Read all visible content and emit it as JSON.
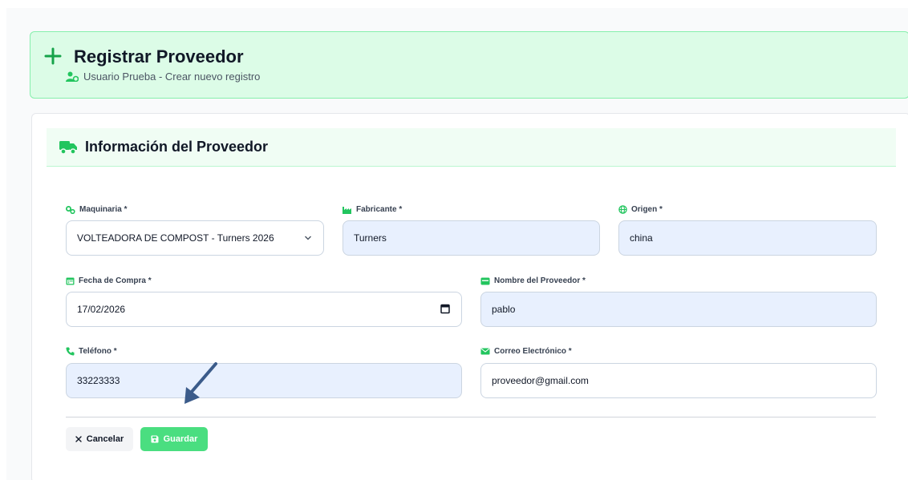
{
  "header": {
    "title": "Registrar Proveedor",
    "subtitle": "Usuario Prueba - Crear nuevo registro"
  },
  "section": {
    "title": "Información del Proveedor"
  },
  "fields": {
    "maquinaria": {
      "label": "Maquinaria *",
      "value": "VOLTEADORA DE COMPOST - Turners 2026",
      "icon": "cogs-icon"
    },
    "fabricante": {
      "label": "Fabricante *",
      "value": "Turners",
      "icon": "industry-icon"
    },
    "origen": {
      "label": "Origen *",
      "value": "china",
      "icon": "globe-icon"
    },
    "fecha_compra": {
      "label": "Fecha de Compra *",
      "value": "17/02/2026",
      "icon": "calendar-icon"
    },
    "nombre_proveedor": {
      "label": "Nombre del Proveedor *",
      "value": "pablo",
      "icon": "id-card-icon"
    },
    "telefono": {
      "label": "Teléfono *",
      "value": "33223333",
      "icon": "phone-icon"
    },
    "correo": {
      "label": "Correo Electrónico *",
      "value": "proveedor@gmail.com",
      "icon": "envelope-icon"
    }
  },
  "buttons": {
    "cancel": "Cancelar",
    "save": "Guardar"
  },
  "colors": {
    "accent": "#22c55e",
    "header_bg": "#dcfce7",
    "filled_input": "#e8f0fe",
    "arrow": "#3b5b8a"
  }
}
